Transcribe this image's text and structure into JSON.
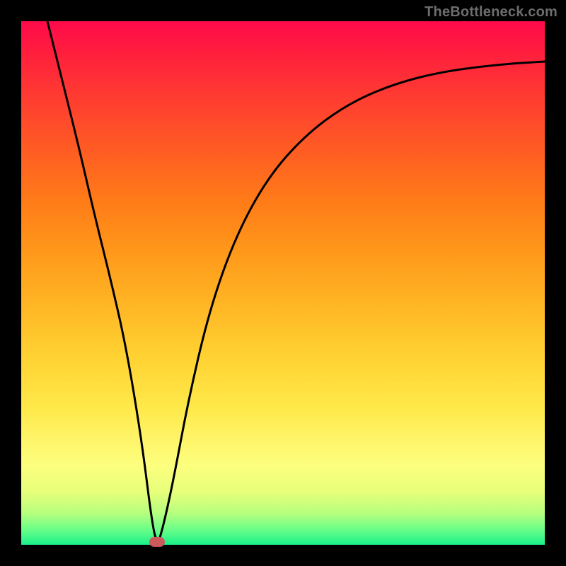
{
  "watermark": "TheBottleneck.com",
  "colors": {
    "frame_border": "#000000",
    "curve_stroke": "#000000",
    "marker_fill": "#cc5a5a"
  },
  "chart_data": {
    "type": "line",
    "title": "",
    "xlabel": "",
    "ylabel": "",
    "xlim": [
      0,
      100
    ],
    "ylim": [
      0,
      100
    ],
    "grid": false,
    "legend": false,
    "series": [
      {
        "name": "bottleneck-curve",
        "x": [
          5,
          8,
          11,
          14,
          17,
          20,
          23,
          25,
          26,
          27,
          29,
          32,
          36,
          41,
          47,
          54,
          62,
          71,
          81,
          92,
          100
        ],
        "values": [
          100,
          88,
          76,
          63,
          51,
          38,
          20,
          4,
          0,
          3,
          12,
          28,
          45,
          59,
          70,
          78,
          84,
          88,
          90.5,
          91.8,
          92.3
        ]
      }
    ],
    "annotations": [
      {
        "name": "min-marker",
        "x": 26,
        "y": 0,
        "shape": "pill",
        "color": "#cc5a5a"
      }
    ],
    "background_gradient": {
      "direction": "vertical",
      "stops": [
        {
          "pos": 0.0,
          "color": "#ff0a4a"
        },
        {
          "pos": 0.5,
          "color": "#ffb524"
        },
        {
          "pos": 0.82,
          "color": "#fcff7e"
        },
        {
          "pos": 1.0,
          "color": "#19f08a"
        }
      ]
    }
  }
}
